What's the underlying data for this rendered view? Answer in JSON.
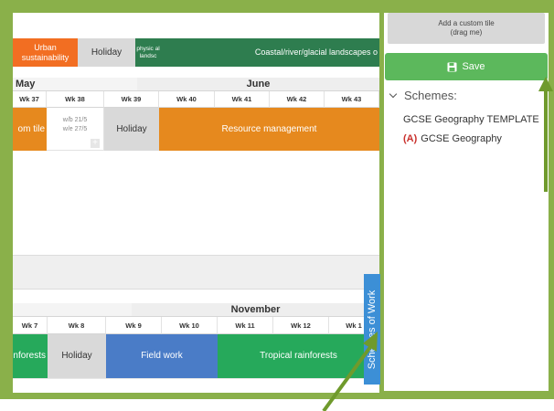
{
  "calendar_top": {
    "unit_tiles": [
      {
        "label": "Urban sustainability",
        "color": "#f26e22"
      },
      {
        "label": "Holiday",
        "color": "#d9d9d9"
      },
      {
        "label": "physic al landsc",
        "color": "#2e7d4f"
      },
      {
        "label": "Coastal/river/glacial landscapes o",
        "color": "#2e7d4f"
      }
    ],
    "months": [
      "May",
      "June"
    ],
    "weeks": [
      "Wk 37",
      "Wk 38",
      "Wk 39",
      "Wk 40",
      "Wk 41",
      "Wk 42",
      "Wk 43"
    ],
    "row_tiles": {
      "custom_tile": {
        "label": "om tile",
        "color": "#e6891e"
      },
      "empty_week": {
        "line1": "w/b 21/5",
        "line2": "w/e 27/5"
      },
      "holiday": {
        "label": "Holiday",
        "color": "#d9d9d9"
      },
      "resource": {
        "label": "Resource management",
        "color": "#e6891e"
      }
    }
  },
  "calendar_bottom": {
    "month": "November",
    "weeks": [
      "Wk 7",
      "Wk 8",
      "Wk 9",
      "Wk 10",
      "Wk 11",
      "Wk 12",
      "Wk 1"
    ],
    "row_tiles": {
      "rainforests_start": {
        "label": "inforests",
        "color": "#26a95b"
      },
      "holiday": {
        "label": "Holiday",
        "color": "#d9d9d9"
      },
      "field_work": {
        "label": "Field work",
        "color": "#4a7cc7"
      },
      "tropical": {
        "label": "Tropical rainforests",
        "color": "#26a95b"
      }
    }
  },
  "schemes_tab": {
    "label": "Schemes of Work",
    "color": "#3c8fd6"
  },
  "sidebar": {
    "custom_tile": {
      "line1": "Add a custom tile",
      "line2": "(drag me)"
    },
    "save_button": {
      "label": "Save",
      "icon": "floppy-disk-icon",
      "color": "#5cb85c"
    },
    "schemes_heading": "Schemes:",
    "schemes": [
      {
        "tag": "",
        "name": "GCSE Geography TEMPLATE"
      },
      {
        "tag": "(A)",
        "name": "GCSE Geography"
      }
    ]
  },
  "annotations": {
    "arrow_color": "#6f9a2c",
    "frame_color": "#8ab04a"
  }
}
